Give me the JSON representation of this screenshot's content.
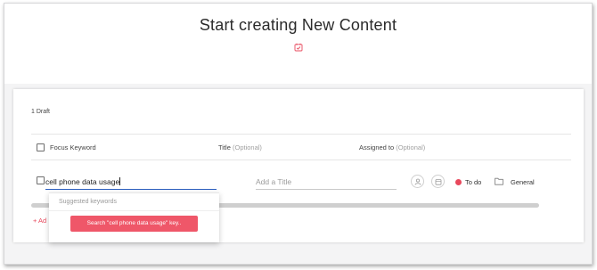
{
  "header": {
    "title": "Start creating New Content",
    "icon": "calendar-check-icon",
    "accent": "#e8485c"
  },
  "drafts": {
    "count_label": "1 Draft"
  },
  "columns": {
    "focus_keyword": "Focus Keyword",
    "title": "Title",
    "title_optional": "(Optional)",
    "assigned_to": "Assigned to",
    "assigned_optional": "(Optional)"
  },
  "row": {
    "keyword_value": "cell phone data usage",
    "title_placeholder": "Add a Title",
    "assignee_icon": "user-icon",
    "date_icon": "calendar-icon",
    "status_label": "To do",
    "status_color": "#e8485c",
    "folder_icon": "folder-icon",
    "folder_label": "General"
  },
  "add_link": {
    "label": "+ Ad"
  },
  "suggestions": {
    "header": "Suggested keywords",
    "search_button": "Search \"cell phone data usage\" key..",
    "button_color": "#ef5769"
  }
}
